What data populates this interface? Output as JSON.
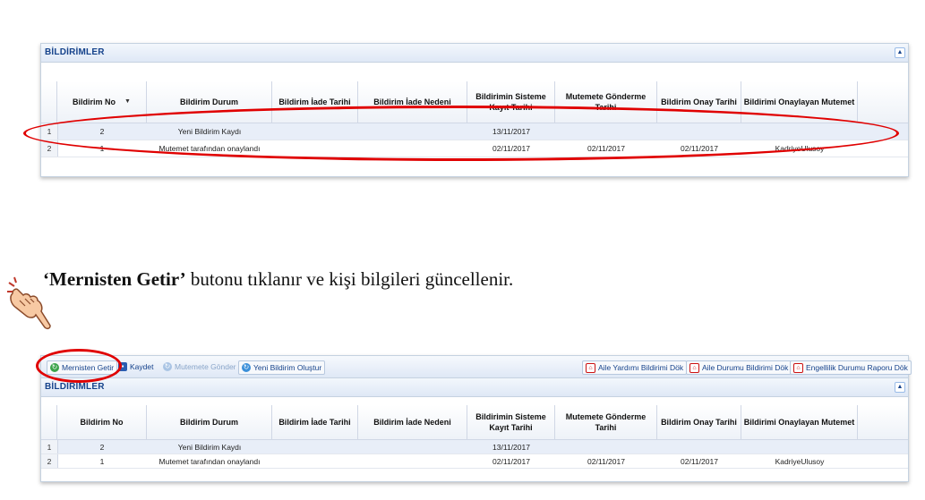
{
  "top_panel": {
    "title": "BİLDİRİMLER",
    "collapse_glyph": "▲",
    "columns": [
      "Bildirim No",
      "Bildirim Durum",
      "Bildirim İade Tarihi",
      "Bildirim İade Nedeni",
      "Bildirimin Sisteme Kayıt Tarihi",
      "Mutemete Gönderme Tarihi",
      "Bildirim Onay Tarihi",
      "Bildirimi Onaylayan Mutemet"
    ],
    "sort_indicator": "▼",
    "rows": [
      {
        "num": "1",
        "cells": [
          "2",
          "Yeni Bildirim Kaydı",
          "",
          "",
          "13/11/2017",
          "",
          "",
          ""
        ]
      },
      {
        "num": "2",
        "cells": [
          "1",
          "Mutemet tarafından onaylandı",
          "",
          "",
          "02/11/2017",
          "02/11/2017",
          "02/11/2017",
          "KadriyeUlusoy"
        ]
      }
    ]
  },
  "instruction": {
    "bold": "‘Mernisten Getir’",
    "rest": " butonu tıklanır ve kişi bilgileri güncellenir."
  },
  "bottom_panel": {
    "toolbar": {
      "mernisten_getir": "Mernisten Getir",
      "kaydet": "Kaydet",
      "mutemete_gonder": "Mutemete Gönder",
      "yeni_bildirim": "Yeni Bildirim Oluştur",
      "aile_yardimi": "Aile Yardımı Bildirimi Dök",
      "aile_durumu": "Aile Durumu Bildirimi Dök",
      "engellilik": "Engellilik Durumu Raporu Dök"
    },
    "title": "BİLDİRİMLER",
    "collapse_glyph": "▲",
    "columns": [
      "Bildirim No",
      "Bildirim Durum",
      "Bildirim İade Tarihi",
      "Bildirim İade Nedeni",
      "Bildirimin Sisteme Kayıt Tarihi",
      "Mutemete Gönderme Tarihi",
      "Bildirim Onay Tarihi",
      "Bildirimi Onaylayan Mutemet"
    ],
    "rows": [
      {
        "num": "1",
        "cells": [
          "2",
          "Yeni Bildirim Kaydı",
          "",
          "",
          "13/11/2017",
          "",
          "",
          ""
        ]
      },
      {
        "num": "2",
        "cells": [
          "1",
          "Mutemet tarafından onaylandı",
          "",
          "",
          "02/11/2017",
          "02/11/2017",
          "02/11/2017",
          "KadriyeUlusoy"
        ]
      }
    ]
  },
  "colors": {
    "highlight": "#e00000",
    "header_text": "#15428b"
  }
}
